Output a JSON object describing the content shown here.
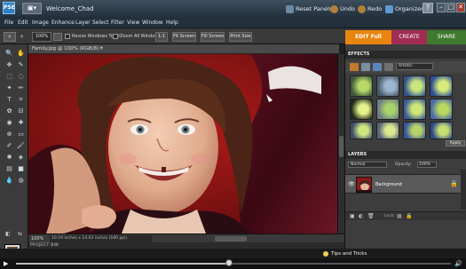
{
  "app": {
    "logo_text": "PSE",
    "document_title": "Welcome_Chad"
  },
  "titlebar": {
    "reset_panels": "Reset Panels",
    "undo": "Undo",
    "redo": "Redo",
    "organizer": "Organizer",
    "help_label": "?",
    "minimize": "–",
    "maximize": "□",
    "close": "✕"
  },
  "menu": [
    "File",
    "Edit",
    "Image",
    "Enhance",
    "Layer",
    "Select",
    "Filter",
    "View",
    "Window",
    "Help"
  ],
  "options_bar": {
    "zoom_value": "100%",
    "resize_windows": "Resize Windows To Fit",
    "zoom_all_windows": "Zoom All Windows",
    "one_to_one": "1:1",
    "fit_screen": "Fit Screen",
    "fill_screen": "Fill Screen",
    "print_size": "Print Size"
  },
  "mode_tabs": {
    "edit": "EDIT Full",
    "create": "CREATE",
    "share": "SHARE"
  },
  "document": {
    "tab": "Family.jpg @ 100% (RGB/8) *",
    "close": "✕"
  },
  "status": {
    "zoom": "100%",
    "size": "10.19 inches x 14.03 inches (180 ppi)"
  },
  "project_bin": {
    "label": "PROJECT BIN"
  },
  "effects_panel": {
    "title": "EFFECTS",
    "category": "Artistic",
    "apply_label": "Apply"
  },
  "layers_panel": {
    "title": "LAYERS",
    "blend_mode": "Normal",
    "opacity_label": "Opacity:",
    "opacity_value": "100%",
    "layer_name": "Background",
    "lock_label": "Lock:"
  },
  "tips": {
    "label": "Tips and Tricks"
  },
  "player": {
    "progress": 0.49
  },
  "colors": {
    "edit_tab": "#e8850f",
    "create_tab": "#a02d52",
    "share_tab": "#3f7a2f"
  }
}
